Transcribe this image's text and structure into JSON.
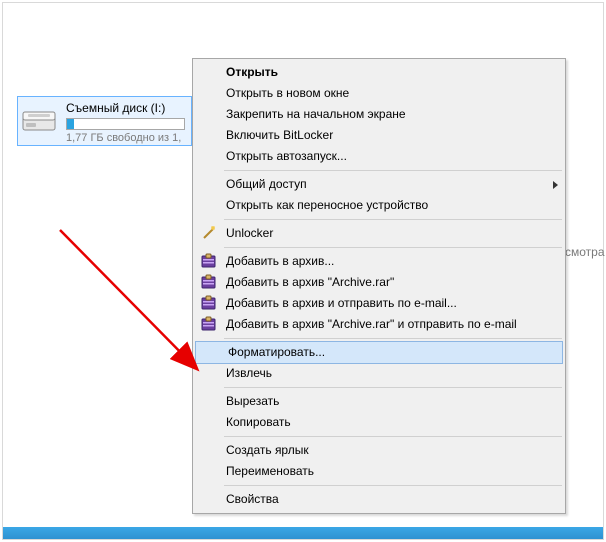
{
  "drive": {
    "title": "Съемный диск (I:)",
    "subtitle": "1,77 ГБ свободно из 1,"
  },
  "menu": {
    "open": "Открыть",
    "open_new_window": "Открыть в новом окне",
    "pin_start": "Закрепить на начальном экране",
    "bitlocker": "Включить BitLocker",
    "autorun": "Открыть автозапуск...",
    "share": "Общий доступ",
    "portable": "Открыть как переносное устройство",
    "unlocker": "Unlocker",
    "add_archive": "Добавить в архив...",
    "add_archive_rar": "Добавить в архив \"Archive.rar\"",
    "add_send_email": "Добавить в архив и отправить по e-mail...",
    "add_rar_send_email": "Добавить в архив \"Archive.rar\" и отправить по e-mail",
    "format": "Форматировать...",
    "eject": "Извлечь",
    "cut": "Вырезать",
    "copy": "Копировать",
    "shortcut": "Создать ярлык",
    "rename": "Переименовать",
    "properties": "Свойства"
  },
  "hint": "смотра"
}
